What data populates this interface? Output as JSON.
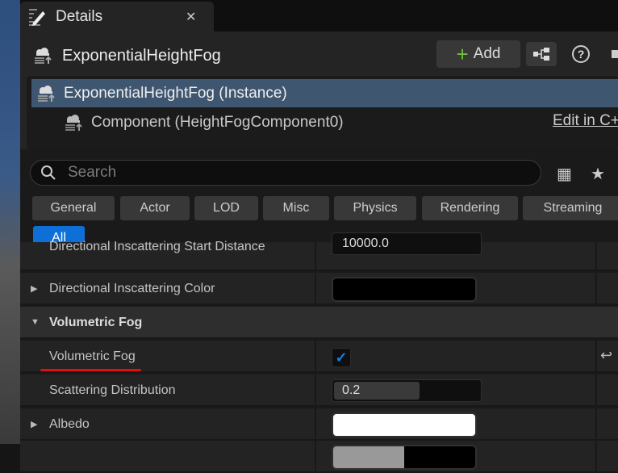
{
  "tab": {
    "title": "Details",
    "close": "✕"
  },
  "header": {
    "actor_name": "ExponentialHeightFog",
    "add_label": "Add",
    "help": "?"
  },
  "tree": {
    "instance": "ExponentialHeightFog (Instance)",
    "component": "Component (HeightFogComponent0)",
    "edit_link": "Edit in C++"
  },
  "search": {
    "placeholder": "Search",
    "value": ""
  },
  "filters": [
    "General",
    "Actor",
    "LOD",
    "Misc",
    "Physics",
    "Rendering",
    "Streaming",
    "All"
  ],
  "properties": {
    "start_distance": {
      "label": "Directional Inscattering Start Distance",
      "value": "10000.0"
    },
    "inscatter_color": {
      "label": "Directional Inscattering Color",
      "color": "#000000"
    },
    "category": {
      "label": "Volumetric Fog"
    },
    "volumetric_fog": {
      "label": "Volumetric Fog",
      "checked": true
    },
    "scattering": {
      "label": "Scattering Distribution",
      "value": "0.2",
      "slider_fraction": 0.58
    },
    "albedo": {
      "label": "Albedo",
      "color": "#ffffff"
    }
  },
  "colors": {
    "accent": "#0f6fd8",
    "selection": "#3f5670",
    "highlight_underline": "#e01010"
  }
}
